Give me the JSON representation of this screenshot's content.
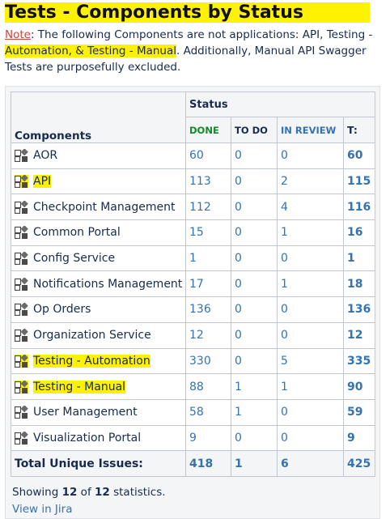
{
  "title": "Tests - Components by Status",
  "note": {
    "label": "Note",
    "text_pre": ": The following Components are not applications: API, Testing - ",
    "text_hl": "Automation, & Testing - Manual",
    "text_post": ". Additionally, Manual API Swagger Tests are purposefully excluded."
  },
  "table": {
    "components_header": "Components",
    "status_header": "Status",
    "columns": {
      "done": "DONE",
      "todo": "TO DO",
      "in_review": "IN REVIEW",
      "total": "T:"
    },
    "rows": [
      {
        "name": "AOR",
        "done": "60",
        "todo": "0",
        "in_review": "0",
        "total": "60",
        "highlighted": false
      },
      {
        "name": "API",
        "done": "113",
        "todo": "0",
        "in_review": "2",
        "total": "115",
        "highlighted": true
      },
      {
        "name": "Checkpoint Management",
        "done": "112",
        "todo": "0",
        "in_review": "4",
        "total": "116",
        "highlighted": false
      },
      {
        "name": "Common Portal",
        "done": "15",
        "todo": "0",
        "in_review": "1",
        "total": "16",
        "highlighted": false
      },
      {
        "name": "Config Service",
        "done": "1",
        "todo": "0",
        "in_review": "0",
        "total": "1",
        "highlighted": false
      },
      {
        "name": "Notifications Management",
        "done": "17",
        "todo": "0",
        "in_review": "1",
        "total": "18",
        "highlighted": false
      },
      {
        "name": "Op Orders",
        "done": "136",
        "todo": "0",
        "in_review": "0",
        "total": "136",
        "highlighted": false
      },
      {
        "name": "Organization Service",
        "done": "12",
        "todo": "0",
        "in_review": "0",
        "total": "12",
        "highlighted": false
      },
      {
        "name": "Testing - Automation",
        "done": "330",
        "todo": "0",
        "in_review": "5",
        "total": "335",
        "highlighted": true
      },
      {
        "name": "Testing - Manual",
        "done": "88",
        "todo": "1",
        "in_review": "1",
        "total": "90",
        "highlighted": true
      },
      {
        "name": "User Management",
        "done": "58",
        "todo": "1",
        "in_review": "0",
        "total": "59",
        "highlighted": false
      },
      {
        "name": "Visualization Portal",
        "done": "9",
        "todo": "0",
        "in_review": "0",
        "total": "9",
        "highlighted": false
      }
    ],
    "totals": {
      "label": "Total Unique Issues:",
      "done": "418",
      "todo": "1",
      "in_review": "6",
      "total": "425"
    }
  },
  "footer": {
    "showing_pre": "Showing ",
    "showing_count": "12",
    "showing_mid": " of ",
    "showing_total": "12",
    "showing_post": " statistics.",
    "view_link": "View in Jira"
  },
  "colors": {
    "highlight": "#fff200",
    "done": "#14892c",
    "link": "#3572b0",
    "note_label": "#d04437"
  },
  "icons": {
    "component": "component-icon"
  }
}
